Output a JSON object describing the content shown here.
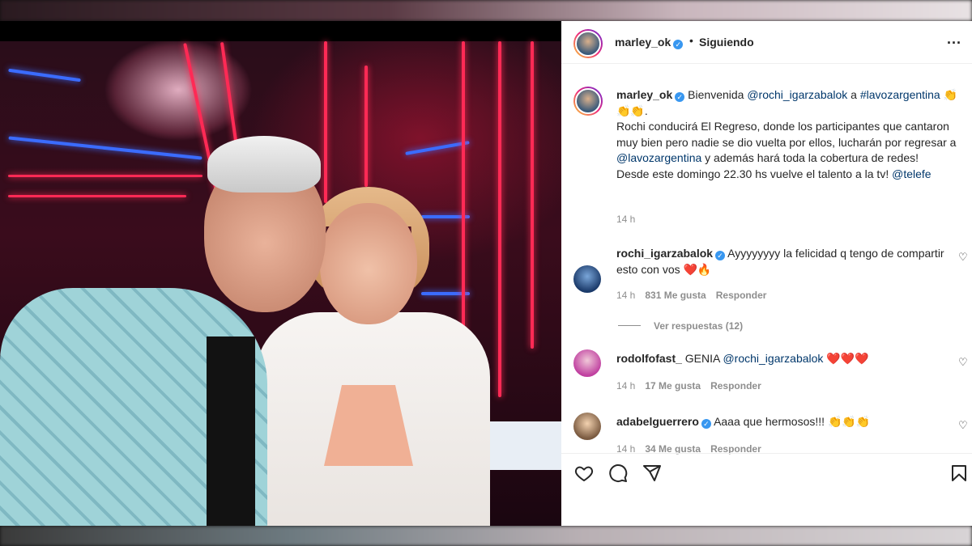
{
  "header": {
    "username": "marley_ok",
    "separator": "•",
    "follow_status": "Siguiendo",
    "more_label": "..."
  },
  "caption": {
    "username": "marley_ok",
    "seg1": "Bienvenida ",
    "mention1": "@rochi_igarzabalok",
    "seg2": " a ",
    "hashtag": "#lavozargentina",
    "emoji1": "👏",
    "emoji2": "👏👏",
    "seg3": ".",
    "line2": "Rochi conducirá El Regreso, donde los participantes que cantaron muy bien pero nadie se dio vuelta por ellos, lucharán por regresar a ",
    "mention2": "@lavozargentina",
    "seg4": " y además hará toda la cobertura de redes!",
    "line3": "Desde este domingo 22.30 hs vuelve el talento a la tv! ",
    "mention3": "@telefe",
    "time": "14 h"
  },
  "comments": [
    {
      "username": "rochi_igarzabalok",
      "verified": true,
      "text": "Ayyyyyyyy la felicidad q tengo de compartir esto con vos ",
      "emoji": "❤️🔥",
      "time": "14 h",
      "likes": "831 Me gusta",
      "reply": "Responder",
      "view_replies": "Ver respuestas (12)"
    },
    {
      "username": "rodolfofast_",
      "verified": false,
      "text": "GENIA ",
      "mention": "@rochi_igarzabalok",
      "emoji": " ❤️❤️❤️",
      "time": "14 h",
      "likes": "17 Me gusta",
      "reply": "Responder"
    },
    {
      "username": "adabelguerrero",
      "verified": true,
      "text": "Aaaa que hermosos!!! ",
      "emoji": "👏👏👏",
      "time": "14 h",
      "likes": "34 Me gusta",
      "reply": "Responder"
    }
  ],
  "icons": {
    "verified": "✓",
    "heart": "♡",
    "like": "heart-icon",
    "comment": "comment-icon",
    "share": "share-icon",
    "save": "bookmark-icon"
  },
  "colors": {
    "verified_blue": "#3897f0",
    "mention_blue": "#00376b",
    "muted": "#8e8e8e",
    "story_ring_start": "#f9ce34",
    "story_ring_mid": "#ee2a7b",
    "story_ring_end": "#6228d7"
  }
}
